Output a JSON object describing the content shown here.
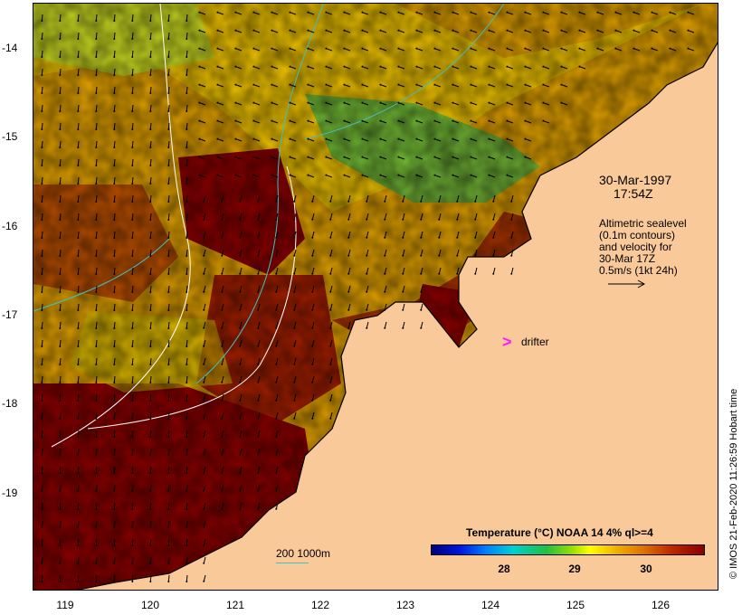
{
  "map": {
    "y_ticks": [
      "-14",
      "-15",
      "-16",
      "-17",
      "-18",
      "-19"
    ],
    "x_ticks": [
      "119",
      "120",
      "121",
      "122",
      "123",
      "124",
      "125",
      "126"
    ],
    "date": "30-Mar-1997",
    "time": "17:54Z",
    "altimetry_lines": [
      "Altimetric sealevel",
      "(0.1m contours)",
      "and velocity for",
      "30-Mar 17Z",
      "0.5m/s (1kt 24h)"
    ],
    "drifter_symbol": ">",
    "drifter_label": "drifter",
    "contour_key": "200  1000m",
    "colorbar_title": "Temperature (°C) NOAA 14 4% ql>=4",
    "colorbar_ticks": [
      "28",
      "29",
      "30"
    ],
    "credit": "© IMOS 21-Feb-2020 11:26:59 Hobart time",
    "colors": {
      "land": "#f9c99a",
      "warm": "#8a0000",
      "drifter": "#ff1aff",
      "contour_200": "#40c0c0",
      "contour_1000": "#ffffff"
    }
  }
}
